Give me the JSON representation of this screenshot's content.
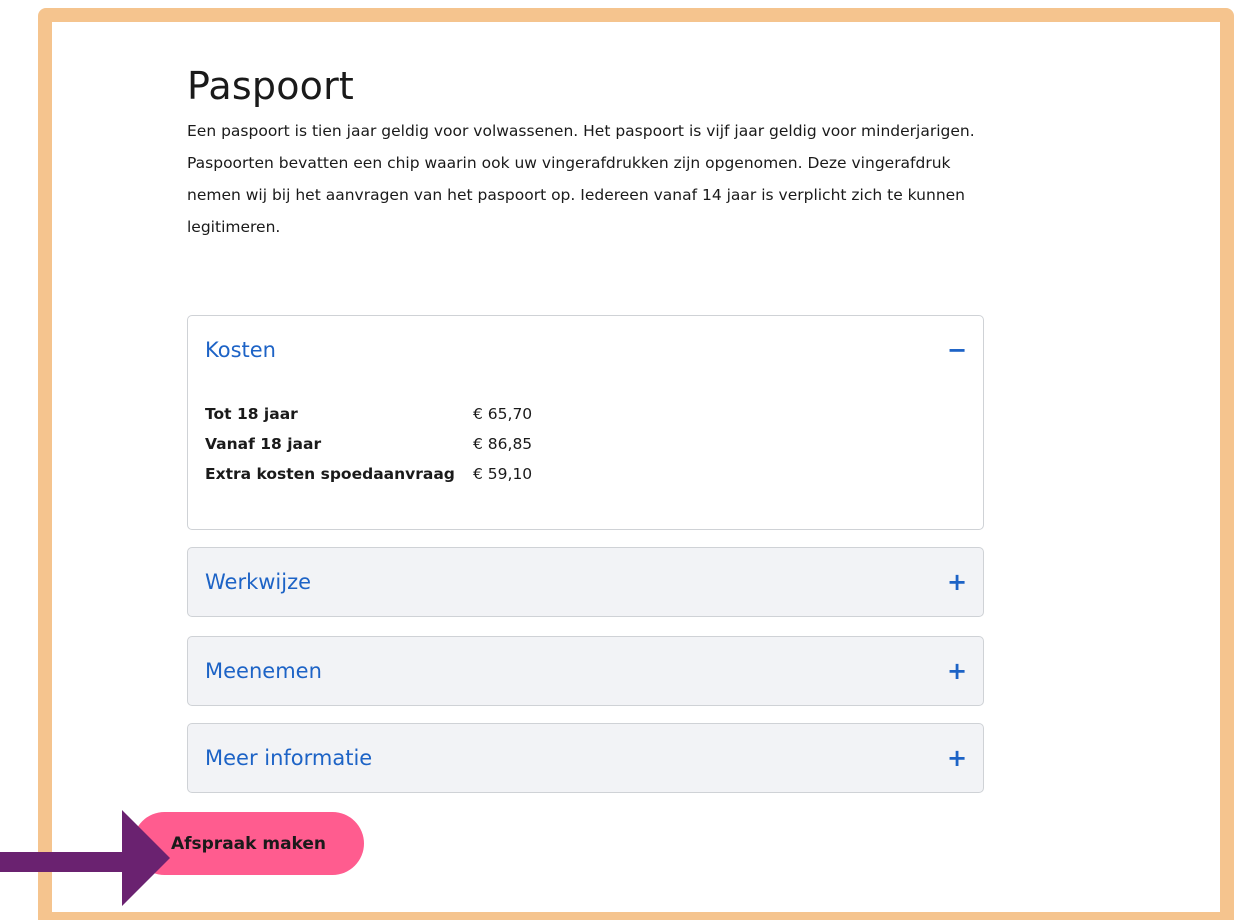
{
  "page": {
    "title": "Paspoort",
    "intro": "Een paspoort is tien jaar geldig voor volwassenen. Het paspoort is vijf jaar geldig voor minderjarigen. Paspoorten bevatten een chip waarin ook uw vingerafdrukken zijn opgenomen. Deze vingerafdruk nemen wij bij het aanvragen van het paspoort op. Iedereen vanaf 14 jaar is verplicht zich te kunnen legitimeren."
  },
  "accordion": {
    "kosten": {
      "title": "Kosten",
      "toggle": "−",
      "rows": [
        {
          "label": "Tot 18 jaar",
          "value": "€ 65,70"
        },
        {
          "label": "Vanaf 18 jaar",
          "value": "€ 86,85"
        },
        {
          "label": "Extra kosten spoedaanvraag",
          "value": "€ 59,10"
        }
      ]
    },
    "werkwijze": {
      "title": "Werkwijze",
      "toggle": "+"
    },
    "meenemen": {
      "title": "Meenemen",
      "toggle": "+"
    },
    "meer_informatie": {
      "title": "Meer informatie",
      "toggle": "+"
    }
  },
  "cta": {
    "label": "Afspraak maken"
  },
  "colors": {
    "frame": "#f5c48e",
    "link": "#1d63c6",
    "cta": "#ff5c8f",
    "arrow": "#6a2270"
  },
  "icons": {
    "arrow": "right-arrow-icon"
  }
}
